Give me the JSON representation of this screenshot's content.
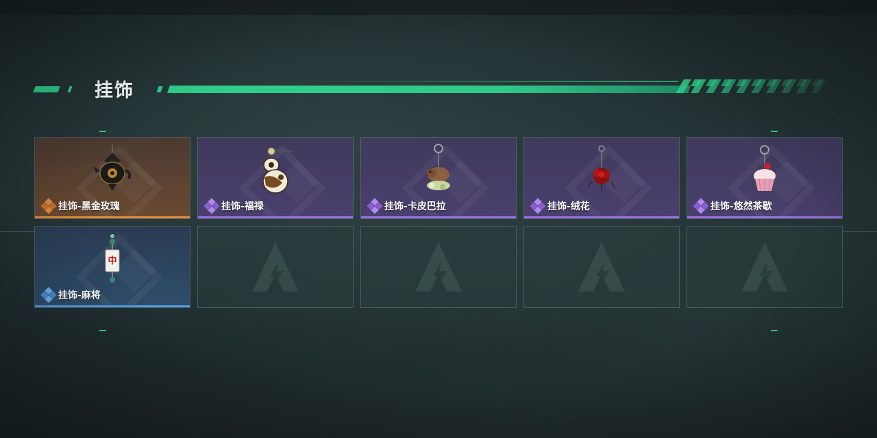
{
  "section": {
    "title": "挂饰"
  },
  "colors": {
    "accent": "#2fd08a",
    "rarity_orange": "#e08a3a",
    "rarity_purple": "#9a6ee0",
    "rarity_blue": "#4b9ae0"
  },
  "items": [
    {
      "name": "挂饰-黑金玫瑰",
      "rarity": "orange",
      "icon": "teapot-rose-charm-icon"
    },
    {
      "name": "挂饰-福禄",
      "rarity": "purple",
      "icon": "gourd-charm-icon"
    },
    {
      "name": "挂饰-卡皮巴拉",
      "rarity": "purple",
      "icon": "capybara-charm-icon"
    },
    {
      "name": "挂饰-绒花",
      "rarity": "purple",
      "icon": "velvet-flower-charm-icon"
    },
    {
      "name": "挂饰-悠然茶歇",
      "rarity": "purple",
      "icon": "cupcake-charm-icon"
    },
    {
      "name": "挂饰-麻将",
      "rarity": "blue",
      "icon": "mahjong-tile-charm-icon"
    }
  ],
  "empty_slots": 4,
  "empty_slot_icon": "game-logo-watermark-icon"
}
